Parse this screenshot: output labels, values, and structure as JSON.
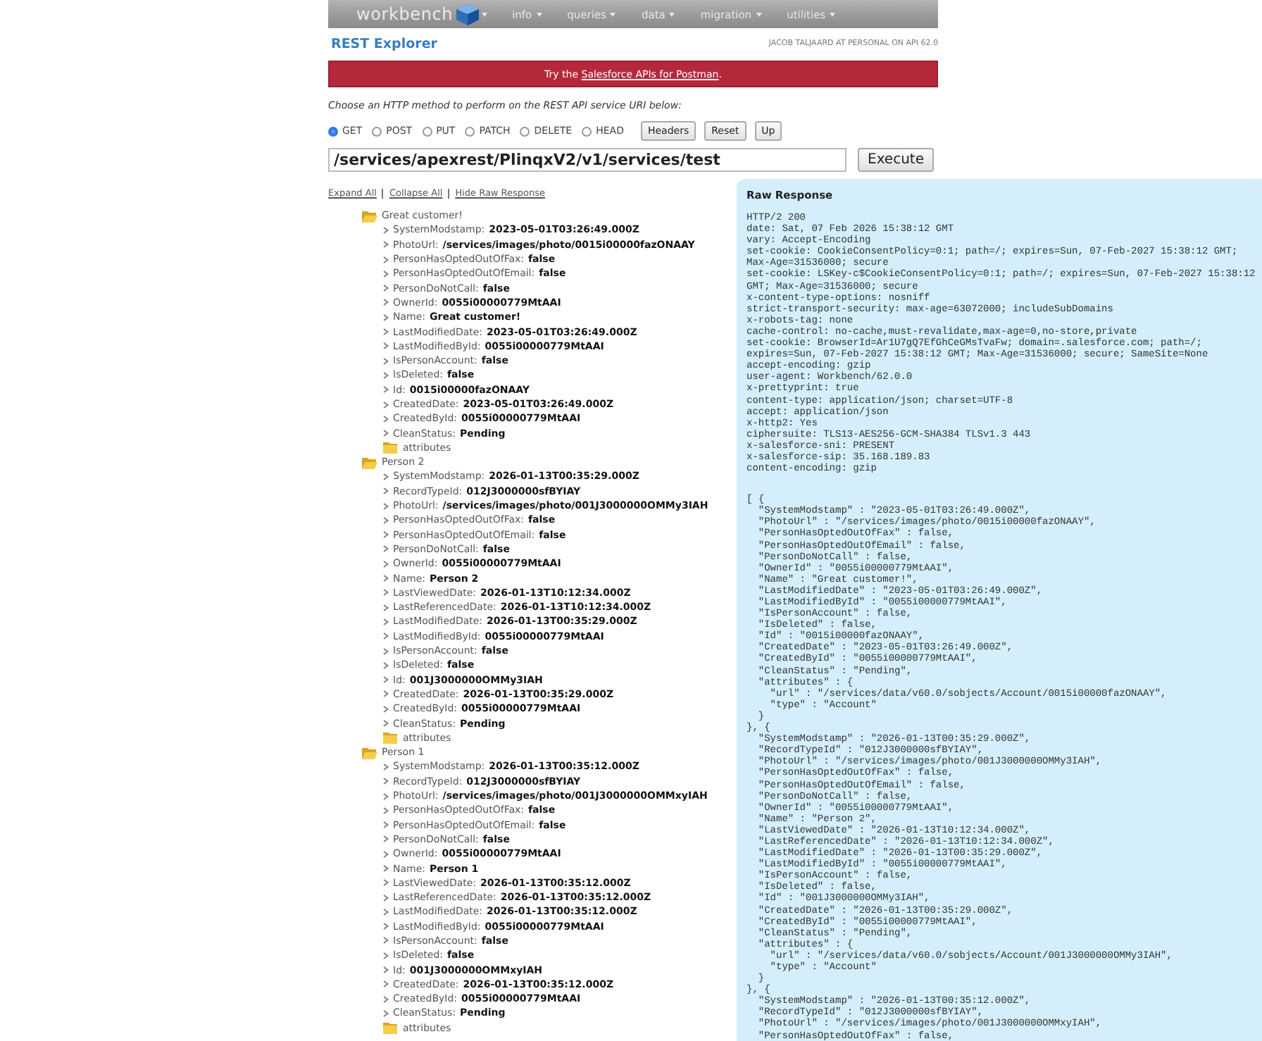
{
  "nav": {
    "logo": "workbench",
    "menus": [
      "info",
      "queries",
      "data",
      "migration",
      "utilities"
    ]
  },
  "page_title": "REST Explorer",
  "user_info": "JACOB TALJAARD AT PERSONAL ON API 62.0",
  "banner": {
    "before": "Try the ",
    "link": "Salesforce APIs for Postman",
    "after": "."
  },
  "instructions": "Choose an HTTP method to perform on the REST API service URI below:",
  "methods": [
    {
      "label": "GET",
      "selected": true
    },
    {
      "label": "POST",
      "selected": false
    },
    {
      "label": "PUT",
      "selected": false
    },
    {
      "label": "PATCH",
      "selected": false
    },
    {
      "label": "DELETE",
      "selected": false
    },
    {
      "label": "HEAD",
      "selected": false
    }
  ],
  "buttons": [
    "Headers",
    "Reset",
    "Up"
  ],
  "uri": {
    "value": "/services/apexrest/PlinqxV2/v1/services/test",
    "button": "Execute"
  },
  "links": [
    "Expand All",
    "Collapse All",
    "Hide Raw Response"
  ],
  "tree": [
    {
      "kind": "folder",
      "label": "Great customer!",
      "expanded": true,
      "children": [
        {
          "kind": "field",
          "key": "SystemModstamp:",
          "value": "2023-05-01T03:26:49.000Z"
        },
        {
          "kind": "field",
          "key": "PhotoUrl:",
          "value": "/services/images/photo/0015i00000fazONAAY"
        },
        {
          "kind": "field",
          "key": "PersonHasOptedOutOfFax:",
          "value": "false"
        },
        {
          "kind": "field",
          "key": "PersonHasOptedOutOfEmail:",
          "value": "false"
        },
        {
          "kind": "field",
          "key": "PersonDoNotCall:",
          "value": "false"
        },
        {
          "kind": "field",
          "key": "OwnerId:",
          "value": "0055i00000779MtAAI"
        },
        {
          "kind": "field",
          "key": "Name:",
          "value": "Great customer!"
        },
        {
          "kind": "field",
          "key": "LastModifiedDate:",
          "value": "2023-05-01T03:26:49.000Z"
        },
        {
          "kind": "field",
          "key": "LastModifiedById:",
          "value": "0055i00000779MtAAI"
        },
        {
          "kind": "field",
          "key": "IsPersonAccount:",
          "value": "false"
        },
        {
          "kind": "field",
          "key": "IsDeleted:",
          "value": "false"
        },
        {
          "kind": "field",
          "key": "Id:",
          "value": "0015i00000fazONAAY"
        },
        {
          "kind": "field",
          "key": "CreatedDate:",
          "value": "2023-05-01T03:26:49.000Z"
        },
        {
          "kind": "field",
          "key": "CreatedById:",
          "value": "0055i00000779MtAAI"
        },
        {
          "kind": "field",
          "key": "CleanStatus:",
          "value": "Pending"
        },
        {
          "kind": "folder",
          "label": "attributes",
          "expanded": false
        }
      ]
    },
    {
      "kind": "folder",
      "label": "Person 2",
      "expanded": true,
      "children": [
        {
          "kind": "field",
          "key": "SystemModstamp:",
          "value": "2026-01-13T00:35:29.000Z"
        },
        {
          "kind": "field",
          "key": "RecordTypeId:",
          "value": "012J3000000sfBYIAY"
        },
        {
          "kind": "field",
          "key": "PhotoUrl:",
          "value": "/services/images/photo/001J3000000OMMy3IAH"
        },
        {
          "kind": "field",
          "key": "PersonHasOptedOutOfFax:",
          "value": "false"
        },
        {
          "kind": "field",
          "key": "PersonHasOptedOutOfEmail:",
          "value": "false"
        },
        {
          "kind": "field",
          "key": "PersonDoNotCall:",
          "value": "false"
        },
        {
          "kind": "field",
          "key": "OwnerId:",
          "value": "0055i00000779MtAAI"
        },
        {
          "kind": "field",
          "key": "Name:",
          "value": "Person 2"
        },
        {
          "kind": "field",
          "key": "LastViewedDate:",
          "value": "2026-01-13T10:12:34.000Z"
        },
        {
          "kind": "field",
          "key": "LastReferencedDate:",
          "value": "2026-01-13T10:12:34.000Z"
        },
        {
          "kind": "field",
          "key": "LastModifiedDate:",
          "value": "2026-01-13T00:35:29.000Z"
        },
        {
          "kind": "field",
          "key": "LastModifiedById:",
          "value": "0055i00000779MtAAI"
        },
        {
          "kind": "field",
          "key": "IsPersonAccount:",
          "value": "false"
        },
        {
          "kind": "field",
          "key": "IsDeleted:",
          "value": "false"
        },
        {
          "kind": "field",
          "key": "Id:",
          "value": "001J3000000OMMy3IAH"
        },
        {
          "kind": "field",
          "key": "CreatedDate:",
          "value": "2026-01-13T00:35:29.000Z"
        },
        {
          "kind": "field",
          "key": "CreatedById:",
          "value": "0055i00000779MtAAI"
        },
        {
          "kind": "field",
          "key": "CleanStatus:",
          "value": "Pending"
        },
        {
          "kind": "folder",
          "label": "attributes",
          "expanded": false
        }
      ]
    },
    {
      "kind": "folder",
      "label": "Person 1",
      "expanded": true,
      "children": [
        {
          "kind": "field",
          "key": "SystemModstamp:",
          "value": "2026-01-13T00:35:12.000Z"
        },
        {
          "kind": "field",
          "key": "RecordTypeId:",
          "value": "012J3000000sfBYIAY"
        },
        {
          "kind": "field",
          "key": "PhotoUrl:",
          "value": "/services/images/photo/001J3000000OMMxyIAH"
        },
        {
          "kind": "field",
          "key": "PersonHasOptedOutOfFax:",
          "value": "false"
        },
        {
          "kind": "field",
          "key": "PersonHasOptedOutOfEmail:",
          "value": "false"
        },
        {
          "kind": "field",
          "key": "PersonDoNotCall:",
          "value": "false"
        },
        {
          "kind": "field",
          "key": "OwnerId:",
          "value": "0055i00000779MtAAI"
        },
        {
          "kind": "field",
          "key": "Name:",
          "value": "Person 1"
        },
        {
          "kind": "field",
          "key": "LastViewedDate:",
          "value": "2026-01-13T00:35:12.000Z"
        },
        {
          "kind": "field",
          "key": "LastReferencedDate:",
          "value": "2026-01-13T00:35:12.000Z"
        },
        {
          "kind": "field",
          "key": "LastModifiedDate:",
          "value": "2026-01-13T00:35:12.000Z"
        },
        {
          "kind": "field",
          "key": "LastModifiedById:",
          "value": "0055i00000779MtAAI"
        },
        {
          "kind": "field",
          "key": "IsPersonAccount:",
          "value": "false"
        },
        {
          "kind": "field",
          "key": "IsDeleted:",
          "value": "false"
        },
        {
          "kind": "field",
          "key": "Id:",
          "value": "001J3000000OMMxyIAH"
        },
        {
          "kind": "field",
          "key": "CreatedDate:",
          "value": "2026-01-13T00:35:12.000Z"
        },
        {
          "kind": "field",
          "key": "CreatedById:",
          "value": "0055i00000779MtAAI"
        },
        {
          "kind": "field",
          "key": "CleanStatus:",
          "value": "Pending"
        },
        {
          "kind": "folder",
          "label": "attributes",
          "expanded": false
        }
      ]
    }
  ],
  "raw_response": {
    "title": "Raw Response",
    "headers": [
      "HTTP/2 200",
      "date: Sat, 07 Feb 2026 15:38:12 GMT",
      "vary: Accept-Encoding",
      "set-cookie: CookieConsentPolicy=0:1; path=/; expires=Sun, 07-Feb-2027 15:38:12 GMT;",
      "Max-Age=31536000; secure",
      "set-cookie: LSKey-c$CookieConsentPolicy=0:1; path=/; expires=Sun, 07-Feb-2027 15:38:12",
      "GMT; Max-Age=31536000; secure",
      "x-content-type-options: nosniff",
      "strict-transport-security: max-age=63072000; includeSubDomains",
      "x-robots-tag: none",
      "cache-control: no-cache,must-revalidate,max-age=0,no-store,private",
      "set-cookie: BrowserId=Ar1U7gQ7EfGhCeGMsTvaFw; domain=.salesforce.com; path=/;",
      "expires=Sun, 07-Feb-2027 15:38:12 GMT; Max-Age=31536000; secure; SameSite=None",
      "accept-encoding: gzip",
      "user-agent: Workbench/62.0.0",
      "x-prettyprint: true",
      "content-type: application/json; charset=UTF-8",
      "accept: application/json",
      "x-http2: Yes",
      "ciphersuite: TLS13-AES256-GCM-SHA384 TLSv1.3 443",
      "x-salesforce-sni: PRESENT",
      "x-salesforce-sip: 35.168.189.83",
      "content-encoding: gzip"
    ],
    "body": [
      "[ {",
      "  \"SystemModstamp\" : \"2023-05-01T03:26:49.000Z\",",
      "  \"PhotoUrl\" : \"/services/images/photo/0015i00000fazONAAY\",",
      "  \"PersonHasOptedOutOfFax\" : false,",
      "  \"PersonHasOptedOutOfEmail\" : false,",
      "  \"PersonDoNotCall\" : false,",
      "  \"OwnerId\" : \"0055i00000779MtAAI\",",
      "  \"Name\" : \"Great customer!\",",
      "  \"LastModifiedDate\" : \"2023-05-01T03:26:49.000Z\",",
      "  \"LastModifiedById\" : \"0055i00000779MtAAI\",",
      "  \"IsPersonAccount\" : false,",
      "  \"IsDeleted\" : false,",
      "  \"Id\" : \"0015i00000fazONAAY\",",
      "  \"CreatedDate\" : \"2023-05-01T03:26:49.000Z\",",
      "  \"CreatedById\" : \"0055i00000779MtAAI\",",
      "  \"CleanStatus\" : \"Pending\",",
      "  \"attributes\" : {",
      "    \"url\" : \"/services/data/v60.0/sobjects/Account/0015i00000fazONAAY\",",
      "    \"type\" : \"Account\"",
      "  }",
      "}, {",
      "  \"SystemModstamp\" : \"2026-01-13T00:35:29.000Z\",",
      "  \"RecordTypeId\" : \"012J3000000sfBYIAY\",",
      "  \"PhotoUrl\" : \"/services/images/photo/001J3000000OMMy3IAH\",",
      "  \"PersonHasOptedOutOfFax\" : false,",
      "  \"PersonHasOptedOutOfEmail\" : false,",
      "  \"PersonDoNotCall\" : false,",
      "  \"OwnerId\" : \"0055i00000779MtAAI\",",
      "  \"Name\" : \"Person 2\",",
      "  \"LastViewedDate\" : \"2026-01-13T10:12:34.000Z\",",
      "  \"LastReferencedDate\" : \"2026-01-13T10:12:34.000Z\",",
      "  \"LastModifiedDate\" : \"2026-01-13T00:35:29.000Z\",",
      "  \"LastModifiedById\" : \"0055i00000779MtAAI\",",
      "  \"IsPersonAccount\" : false,",
      "  \"IsDeleted\" : false,",
      "  \"Id\" : \"001J3000000OMMy3IAH\",",
      "  \"CreatedDate\" : \"2026-01-13T00:35:29.000Z\",",
      "  \"CreatedById\" : \"0055i00000779MtAAI\",",
      "  \"CleanStatus\" : \"Pending\",",
      "  \"attributes\" : {",
      "    \"url\" : \"/services/data/v60.0/sobjects/Account/001J3000000OMMy3IAH\",",
      "    \"type\" : \"Account\"",
      "  }",
      "}, {",
      "  \"SystemModstamp\" : \"2026-01-13T00:35:12.000Z\",",
      "  \"RecordTypeId\" : \"012J3000000sfBYIAY\",",
      "  \"PhotoUrl\" : \"/services/images/photo/001J3000000OMMxyIAH\",",
      "  \"PersonHasOptedOutOfFax\" : false,"
    ]
  }
}
